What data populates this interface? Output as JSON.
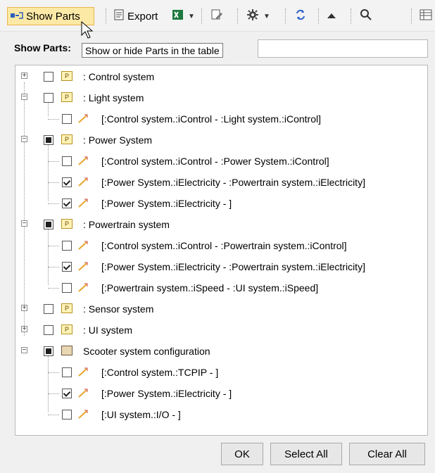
{
  "toolbar": {
    "show_parts": "Show Parts",
    "export": "Export"
  },
  "dialog": {
    "label": "Show Parts:",
    "tooltip": "Show or hide Parts in the table",
    "filter_value": ""
  },
  "tree": {
    "rows": [
      {
        "label": ": Control system"
      },
      {
        "label": ": Light system"
      },
      {
        "label": "[:Control system.:iControl - :Light system.:iControl]"
      },
      {
        "label": ": Power System"
      },
      {
        "label": "[:Control system.:iControl - :Power System.:iControl]"
      },
      {
        "label": "[:Power System.:iElectricity - :Powertrain system.:iElectricity]"
      },
      {
        "label": "[:Power System.:iElectricity - ]"
      },
      {
        "label": ": Powertrain system"
      },
      {
        "label": "[:Control system.:iControl - :Powertrain system.:iControl]"
      },
      {
        "label": "[:Power System.:iElectricity - :Powertrain system.:iElectricity]"
      },
      {
        "label": "[:Powertrain system.:iSpeed - :UI system.:iSpeed]"
      },
      {
        "label": ": Sensor system"
      },
      {
        "label": ": UI system"
      },
      {
        "label": "Scooter system configuration"
      },
      {
        "label": "[:Control system.:TCPIP - ]"
      },
      {
        "label": "[:Power System.:iElectricity - ]"
      },
      {
        "label": "[:UI system.:I/O - ]"
      }
    ]
  },
  "buttons": {
    "ok": "OK",
    "select_all": "Select All",
    "clear_all": "Clear All"
  }
}
